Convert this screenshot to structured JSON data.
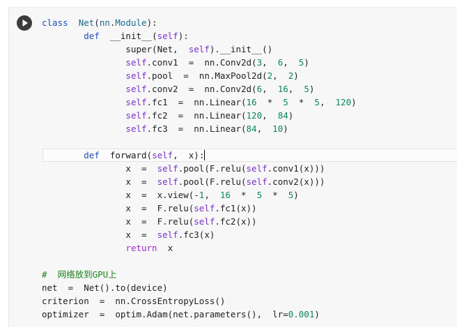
{
  "cell": {
    "run_button_label": "Run cell",
    "lines": [
      "class  Net(nn.Module):",
      "        def  __init__(self):",
      "                super(Net,  self).__init__()",
      "                self.conv1  =  nn.Conv2d(3,  6,  5)",
      "                self.pool  =  nn.MaxPool2d(2,  2)",
      "                self.conv2  =  nn.Conv2d(6,  16,  5)",
      "                self.fc1  =  nn.Linear(16  *  5  *  5,  120)",
      "                self.fc2  =  nn.Linear(120,  84)",
      "                self.fc3  =  nn.Linear(84,  10)",
      "",
      "        def  forward(self,  x):",
      "                x  =  self.pool(F.relu(self.conv1(x)))",
      "                x  =  self.pool(F.relu(self.conv2(x)))",
      "                x  =  x.view(-1,  16  *  5  *  5)",
      "                x  =  F.relu(self.fc1(x))",
      "                x  =  F.relu(self.fc2(x))",
      "                x  =  self.fc3(x)",
      "                return  x",
      "",
      "#  网络放到GPU上",
      "net  =  Net().to(device)",
      "criterion  =  nn.CrossEntropyLoss()",
      "optimizer  =  optim.Adam(net.parameters(),  lr=0.001)"
    ]
  },
  "colors": {
    "keyword": "#1a4dbd",
    "class_name": "#1a6a8c",
    "number": "#098658",
    "self": "#7b30c7",
    "comment": "#198019",
    "return": "#9f27c6",
    "cell_background": "#f7f7f7"
  },
  "icons": {
    "run": "play-circle-icon"
  }
}
